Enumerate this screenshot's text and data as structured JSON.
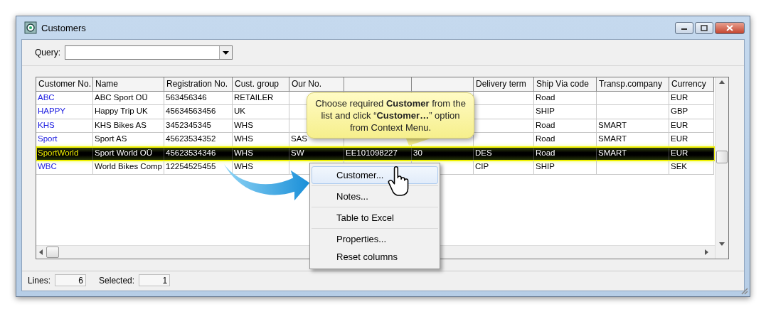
{
  "window": {
    "title": "Customers"
  },
  "query": {
    "label": "Query:"
  },
  "table": {
    "columns": [
      {
        "label": "Customer No."
      },
      {
        "label": "Name"
      },
      {
        "label": "Registration No."
      },
      {
        "label": "Cust. group"
      },
      {
        "label": "Our No."
      },
      {},
      {},
      {
        "label": "Delivery term"
      },
      {
        "label": "Ship Via code"
      },
      {
        "label": "Transp.company"
      },
      {
        "label": "Currency"
      }
    ],
    "rows": [
      {
        "selected": false,
        "cells": [
          "ABC",
          "ABC Sport OÜ",
          "563456346",
          "RETAILER",
          null,
          null,
          null,
          null,
          "Road",
          null,
          "EUR"
        ]
      },
      {
        "selected": false,
        "cells": [
          "HAPPY",
          "Happy Trip UK",
          "45634563456",
          "UK",
          null,
          null,
          null,
          null,
          "SHIP",
          null,
          "GBP"
        ]
      },
      {
        "selected": false,
        "cells": [
          "KHS",
          "KHS Bikes AS",
          "3452345345",
          "WHS",
          null,
          null,
          null,
          null,
          "Road",
          "SMART",
          "EUR"
        ]
      },
      {
        "selected": false,
        "cells": [
          "Sport",
          "Sport AS",
          "45623534352",
          "WHS",
          "SAS",
          null,
          null,
          null,
          "Road",
          "SMART",
          "EUR"
        ]
      },
      {
        "selected": true,
        "cells": [
          "SportWorld",
          "Sport World OÜ",
          "45623534346",
          "WHS",
          "SW",
          "EE101098227",
          "30",
          "DES",
          "Road",
          "SMART",
          "EUR"
        ]
      },
      {
        "selected": false,
        "cells": [
          "WBC",
          "World Bikes Comp",
          "12254525455",
          "WHS",
          null,
          null,
          null,
          "CIP",
          "SHIP",
          null,
          "SEK"
        ]
      }
    ]
  },
  "callout": {
    "text": "Choose required **Customer** from the list and click “**Customer…**” option from Context Menu."
  },
  "context_menu": {
    "groups": [
      [
        {
          "label": "Customer...",
          "selected": true
        }
      ],
      [
        {
          "label": "Notes...",
          "selected": false
        }
      ],
      [
        {
          "label": "Table to Excel",
          "selected": false
        }
      ],
      [
        {
          "label": "Properties...",
          "selected": false
        },
        {
          "label": "Reset columns",
          "selected": false
        }
      ]
    ]
  },
  "status_bar": {
    "lines_label": "Lines:",
    "lines": "6",
    "selected_label": "Selected:",
    "selected": "1"
  }
}
